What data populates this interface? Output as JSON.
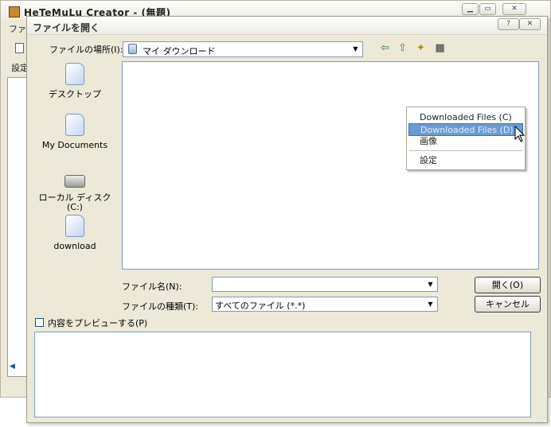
{
  "background_window": {
    "title": "HeTeMuLu Creator - (無題)",
    "menu_fragment": "ファ",
    "settings_fragment": "設定",
    "app_icon": "app-logo-icon",
    "caption_buttons": [
      "minimize",
      "maximize",
      "close"
    ]
  },
  "dialog": {
    "title": "ファイルを開く",
    "help_glyph": "?",
    "close_glyph": "✕",
    "look_in": {
      "label": "ファイルの場所(I):",
      "value": "マイ ダウンロード"
    },
    "toolbar": {
      "back_glyph": "⇦",
      "up_glyph": "⇧",
      "newfolder_glyph": "✦",
      "view_glyph": "▦"
    },
    "places": [
      {
        "label": "デスクトップ",
        "icon": "desktop-folder-icon"
      },
      {
        "label": "My Documents",
        "icon": "documents-folder-icon"
      },
      {
        "label": "ローカル ディスク",
        "label2": "(C:)",
        "icon": "disk-drive-icon"
      },
      {
        "label": "download",
        "icon": "download-folder-icon"
      }
    ],
    "context_menu": {
      "items": [
        "Downloaded Files (C)",
        "Downloaded Files (D)",
        "画像",
        "設定"
      ],
      "highlighted_index": 1
    },
    "filename": {
      "label": "ファイル名(N):",
      "value": ""
    },
    "filetype": {
      "label": "ファイルの種類(T):",
      "value": "すべてのファイル (*.*)"
    },
    "buttons": {
      "open": "開く(O)",
      "cancel": "キャンセル"
    },
    "preview": {
      "label": "内容をプレビューする(P)",
      "checked": false
    }
  }
}
